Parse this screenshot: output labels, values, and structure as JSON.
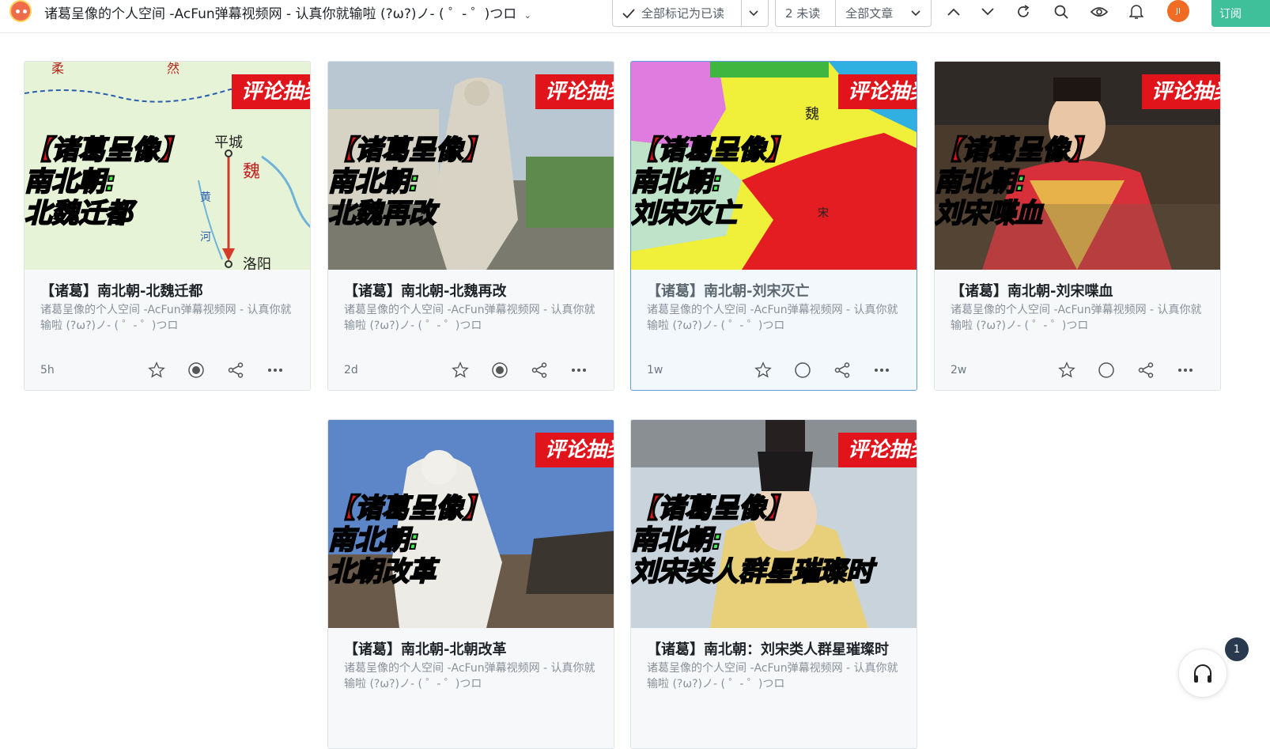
{
  "header": {
    "feed_title": "诸葛呈像的个人空间 -AcFun弹幕视频网 - 认真你就输啦 (?ω?)ノ- ( ゜- ゜)つロ",
    "mark_all_read": "全部标记为已读",
    "unread": "2 未读",
    "all_articles": "全部文章",
    "avatar_text": "JI",
    "subscribe": "订阅",
    "icon_names": [
      "check-icon",
      "chevron-down-icon",
      "chevron-up-icon",
      "refresh-icon",
      "search-icon",
      "eye-icon",
      "bell-icon"
    ]
  },
  "thumbnail_overlay": {
    "badge": "评论抽奖",
    "line1": "【诸葛呈像】"
  },
  "cards": [
    {
      "title": "【诸葛】南北朝-北魏迁都",
      "desc": "诸葛呈像的个人空间 -AcFun弹幕视频网 - 认真你就输啦 (?ω?)ノ- ( ゜- ゜)つロ",
      "time": "5h",
      "line2": "南北朝:",
      "line3": "北魏迁都",
      "read": false,
      "map_labels": [
        "平城",
        "魏",
        "洛阳",
        "柔",
        "然",
        "黄",
        "河"
      ]
    },
    {
      "title": "【诸葛】南北朝-北魏再改",
      "desc": "诸葛呈像的个人空间 -AcFun弹幕视频网 - 认真你就输啦 (?ω?)ノ- ( ゜- ゜)つロ",
      "time": "2d",
      "line2": "南北朝:",
      "line3": "北魏再改",
      "read": false
    },
    {
      "title": "【诸葛】南北朝-刘宋灭亡",
      "desc": "诸葛呈像的个人空间 -AcFun弹幕视频网 - 认真你就输啦 (?ω?)ノ- ( ゜- ゜)つロ",
      "time": "1w",
      "line2": "南北朝:",
      "line3": "刘宋灭亡",
      "read": true,
      "map_labels": [
        "魏",
        "宋"
      ]
    },
    {
      "title": "【诸葛】南北朝-刘宋喋血",
      "desc": "诸葛呈像的个人空间 -AcFun弹幕视频网 - 认真你就输啦 (?ω?)ノ- ( ゜- ゜)つロ",
      "time": "2w",
      "line2": "南北朝:",
      "line3": "刘宋喋血",
      "read": true
    },
    {
      "title": "【诸葛】南北朝-北朝改革",
      "desc": "诸葛呈像的个人空间 -AcFun弹幕视频网 - 认真你就输啦 (?ω?)ノ- ( ゜- ゜)つロ",
      "line2": "南北朝:",
      "line3": "北朝改革"
    },
    {
      "title": "【诸葛】南北朝：刘宋类人群星璀璨时",
      "desc": "诸葛呈像的个人空间 -AcFun弹幕视频网 - 认真你就输啦 (?ω?)ノ- ( ゜- ゜)つロ",
      "line2": "南北朝:",
      "line3": "刘宋类人群星璀璨时"
    }
  ],
  "badge_count": "1",
  "colors": {
    "accent": "#5d9de6",
    "subscribe": "#3fbf9a",
    "overlay_red": "#e0141a",
    "overlay_green": "#3df04a"
  }
}
